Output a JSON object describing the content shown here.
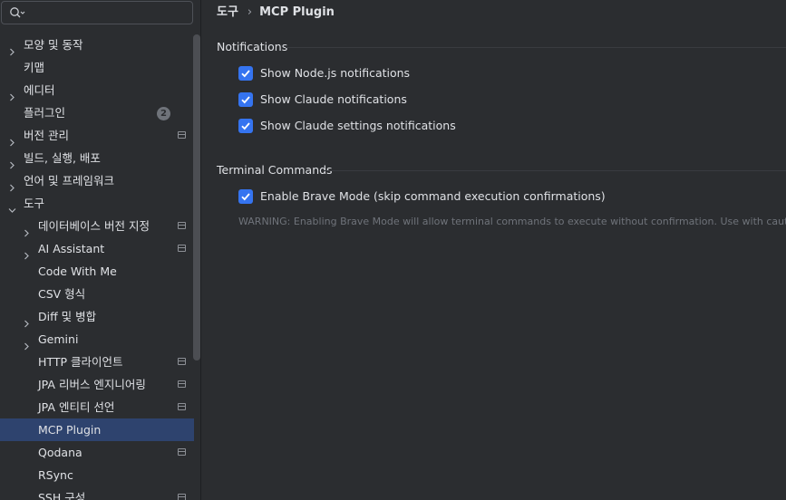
{
  "search": {
    "value": "",
    "placeholder": ""
  },
  "sidebar": {
    "items": [
      {
        "label": "모양 및 동작",
        "chevron": true,
        "level": 0,
        "pane": false
      },
      {
        "label": "키맵",
        "chevron": false,
        "level": 0,
        "pane": false
      },
      {
        "label": "에디터",
        "chevron": true,
        "level": 0,
        "pane": false
      },
      {
        "label": "플러그인",
        "chevron": false,
        "level": 0,
        "pane": false,
        "badge": "2"
      },
      {
        "label": "버전 관리",
        "chevron": true,
        "level": 0,
        "pane": true
      },
      {
        "label": "빌드, 실행, 배포",
        "chevron": true,
        "level": 0,
        "pane": false
      },
      {
        "label": "언어 및 프레임워크",
        "chevron": true,
        "level": 0,
        "pane": false
      },
      {
        "label": "도구",
        "chevron": true,
        "expanded": true,
        "level": 0,
        "pane": false
      },
      {
        "label": "데이터베이스 버전 지정",
        "chevron": true,
        "level": 1,
        "pane": true
      },
      {
        "label": "AI Assistant",
        "chevron": true,
        "level": 1,
        "pane": true
      },
      {
        "label": "Code With Me",
        "chevron": false,
        "level": 1,
        "pane": false
      },
      {
        "label": "CSV 형식",
        "chevron": false,
        "level": 1,
        "pane": false
      },
      {
        "label": "Diff 및 병합",
        "chevron": true,
        "level": 1,
        "pane": false
      },
      {
        "label": "Gemini",
        "chevron": true,
        "level": 1,
        "pane": false
      },
      {
        "label": "HTTP 클라이언트",
        "chevron": false,
        "level": 1,
        "pane": true
      },
      {
        "label": "JPA 리버스 엔지니어링",
        "chevron": false,
        "level": 1,
        "pane": true
      },
      {
        "label": "JPA 엔티티 선언",
        "chevron": false,
        "level": 1,
        "pane": true
      },
      {
        "label": "MCP Plugin",
        "chevron": false,
        "level": 1,
        "pane": false,
        "selected": true
      },
      {
        "label": "Qodana",
        "chevron": false,
        "level": 1,
        "pane": true
      },
      {
        "label": "RSync",
        "chevron": false,
        "level": 1,
        "pane": false
      },
      {
        "label": "SSH 구성",
        "chevron": false,
        "level": 1,
        "pane": true
      }
    ]
  },
  "breadcrumb": {
    "parent": "도구",
    "separator": "›",
    "current": "MCP Plugin"
  },
  "notifications": {
    "title": "Notifications",
    "options": [
      {
        "label": "Show Node.js notifications",
        "checked": true
      },
      {
        "label": "Show Claude notifications",
        "checked": true
      },
      {
        "label": "Show Claude settings notifications",
        "checked": true
      }
    ]
  },
  "terminal": {
    "title": "Terminal Commands",
    "brave_label": "Enable Brave Mode (skip command execution confirmations)",
    "brave_checked": true,
    "warning": "WARNING: Enabling Brave Mode will allow terminal commands to execute without confirmation. Use with caution."
  },
  "colors": {
    "background": "#2b2d30",
    "selected": "#2e436e",
    "checkbox": "#3574f0",
    "text": "#dfe1e5",
    "muted": "#6f737a"
  }
}
